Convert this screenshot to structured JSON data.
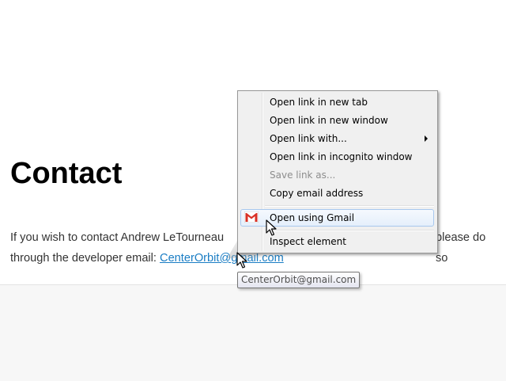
{
  "page": {
    "title": "Contact",
    "paragraph": {
      "line1_left": "If you wish to contact Andrew LeTourneau",
      "line1_right": "please do so",
      "line2_text": "through the developer email: ",
      "email_link": "CenterOrbit@gmail.com"
    }
  },
  "context_menu": {
    "items": [
      {
        "label": "Open link in new tab",
        "enabled": true
      },
      {
        "label": "Open link in new window",
        "enabled": true
      },
      {
        "label": "Open link with...",
        "enabled": true,
        "submenu": true
      },
      {
        "label": "Open link in incognito window",
        "enabled": true
      },
      {
        "label": "Save link as...",
        "enabled": false
      },
      {
        "label": "Copy email address",
        "enabled": true
      },
      {
        "label": "Open using Gmail",
        "enabled": true,
        "icon": "gmail-icon",
        "highlighted": true
      },
      {
        "label": "Inspect element",
        "enabled": true
      }
    ]
  },
  "tooltip": {
    "text": "CenterOrbit@gmail.com"
  },
  "colors": {
    "link": "#1a7dc4",
    "gmail_red": "#d93025",
    "menu_background": "#f0f0f0",
    "highlight_border": "#a8c8ee"
  }
}
